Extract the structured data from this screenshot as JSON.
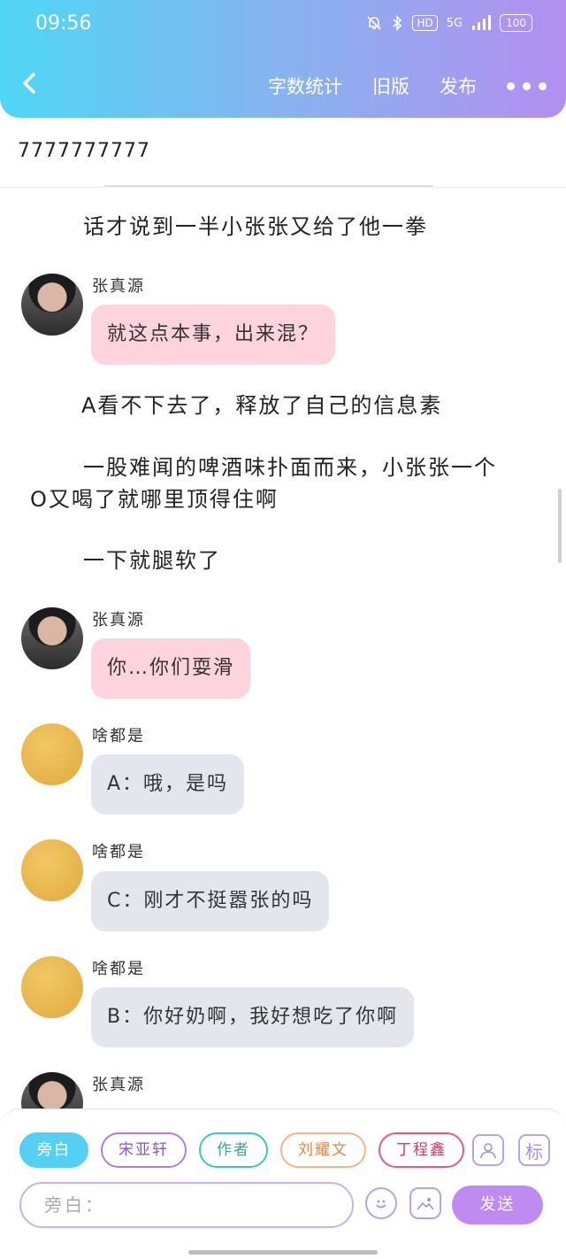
{
  "status_bar": {
    "time": "09:56",
    "hd": "HD",
    "network": "5G",
    "battery": "100"
  },
  "header": {
    "actions": [
      "字数统计",
      "旧版",
      "发布"
    ]
  },
  "title": "7777777777",
  "colors": {
    "header_start": "#4fd6f4",
    "header_end": "#b38ff0",
    "pink_bubble": "#fdd3de",
    "gray_bubble": "#e3e7ed",
    "send_button": "#c08bf0"
  },
  "content": {
    "narration_1": "话才说到一半小张张又给了他一拳",
    "msg_1": {
      "sender": "张真源",
      "text": "就这点本事，出来混？"
    },
    "narration_2": "A看不下去了，释放了自己的信息素",
    "narration_3_line1": "一股难闻的啤酒味扑面而来，小张张一个",
    "narration_3_line2": "O又喝了就哪里顶得住啊",
    "narration_4": "一下就腿软了",
    "msg_2": {
      "sender": "张真源",
      "text": "你…你们耍滑"
    },
    "msg_3": {
      "sender": "啥都是",
      "text": "A：哦，是吗"
    },
    "msg_4": {
      "sender": "啥都是",
      "text": "C：刚才不挺嚣张的吗"
    },
    "msg_5": {
      "sender": "啥都是",
      "text": "B：你好奶啊，我好想吃了你啊"
    },
    "msg_6": {
      "sender": "张真源"
    }
  },
  "bottom": {
    "roles": [
      "旁白",
      "宋亚轩",
      "作者",
      "刘耀文",
      "丁程鑫"
    ],
    "tag_label": "标",
    "input_placeholder": "旁白：",
    "send_label": "发送"
  }
}
